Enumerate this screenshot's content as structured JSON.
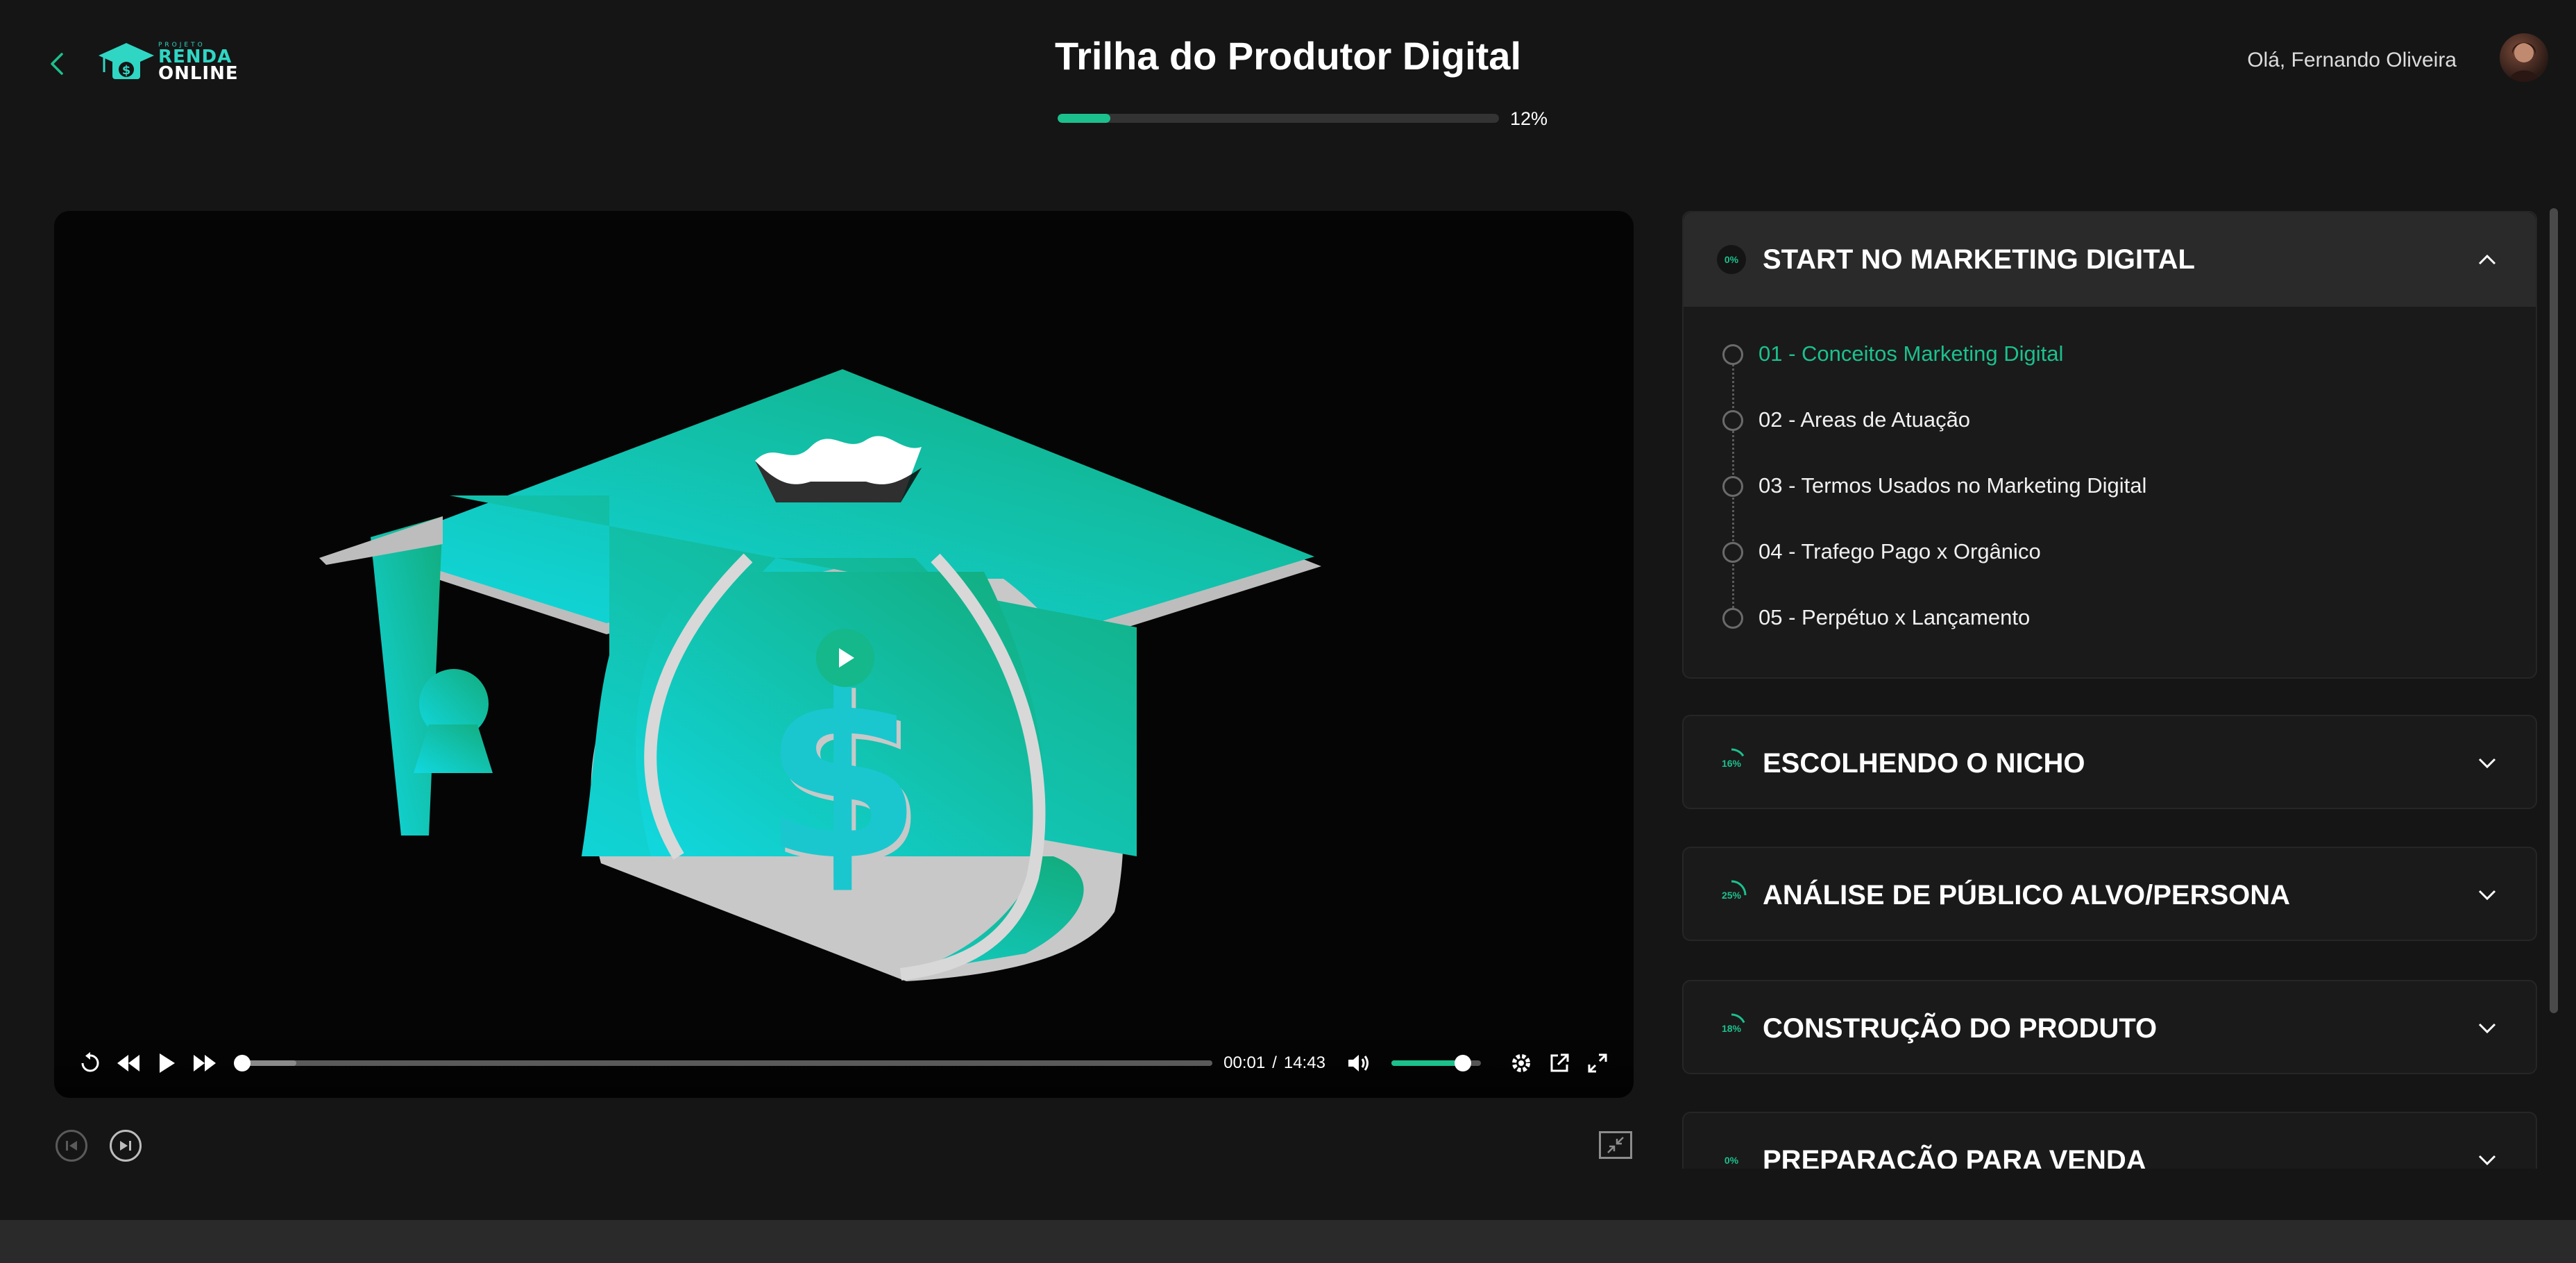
{
  "header": {
    "back_icon": "chevron-left-icon",
    "logo": {
      "small_text": "PROJETO",
      "line1": "RENDA",
      "line2": "ONLINE"
    },
    "title": "Trilha do Produtor Digital",
    "progress": {
      "value": 0.12,
      "label": "12%"
    },
    "greeting": "Olá, Fernando Oliveira"
  },
  "player": {
    "current_time": "00:01",
    "separator": "/",
    "duration": "14:43",
    "volume": 0.8,
    "played_fraction": 0.0,
    "icons": [
      "replay-icon",
      "rewind-icon",
      "play-icon",
      "fast-forward-icon",
      "volume-icon",
      "settings-icon",
      "popout-icon",
      "fullscreen-icon"
    ]
  },
  "below_player": {
    "prev_icon": "skip-previous-icon",
    "next_icon": "skip-next-icon",
    "minimize_icon": "minimize-icon"
  },
  "modules": [
    {
      "title": "START NO MARKETING DIGITAL",
      "progress_label": "0%",
      "progress": 0,
      "open": true,
      "lessons": [
        {
          "label": "01 - Conceitos Marketing Digital",
          "active": true
        },
        {
          "label": "02 - Areas de Atuação",
          "active": false
        },
        {
          "label": "03 - Termos Usados no Marketing Digital",
          "active": false
        },
        {
          "label": "04 - Trafego Pago x Orgânico",
          "active": false
        },
        {
          "label": "05 - Perpétuo x Lançamento",
          "active": false
        }
      ]
    },
    {
      "title": "ESCOLHENDO O NICHO",
      "progress_label": "16%",
      "progress": 0.16,
      "open": false
    },
    {
      "title": "ANÁLISE DE PÚBLICO ALVO/PERSONA",
      "progress_label": "25%",
      "progress": 0.25,
      "open": false
    },
    {
      "title": "CONSTRUÇÃO DO PRODUTO",
      "progress_label": "18%",
      "progress": 0.18,
      "open": false
    },
    {
      "title": "PREPARAÇÃO PARA VENDA",
      "progress_label": "0%",
      "progress": 0,
      "open": false
    }
  ],
  "colors": {
    "accent": "#1cc08d",
    "background": "#151515",
    "panel": "#1a1a1a",
    "logo_teal": "#2fd6c4"
  }
}
